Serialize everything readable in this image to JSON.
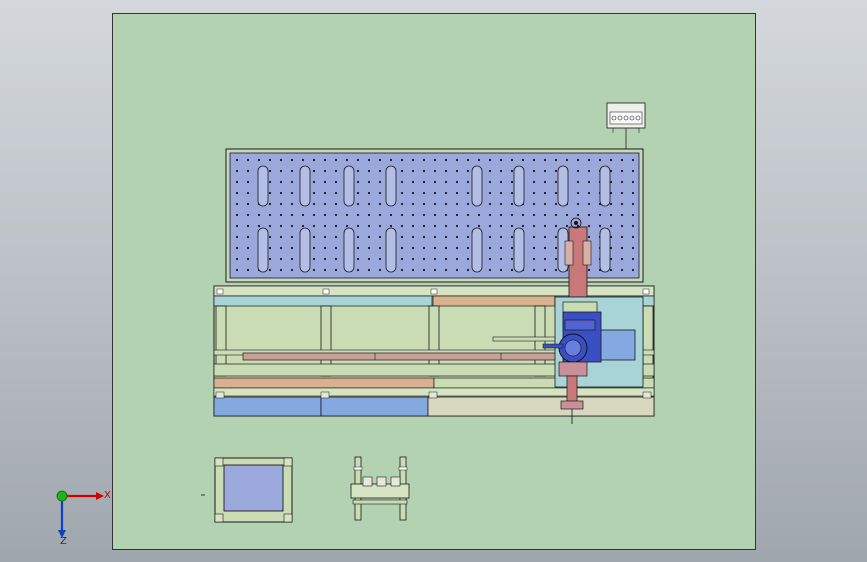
{
  "viewport": {
    "background": "#c7ccd1",
    "sheet_color": "#b3d2b2"
  },
  "drawing": {
    "line_color": "#1a1a1a",
    "plate_color": "#9ba8dc",
    "frame_color": "#c9dcb4",
    "panel_tan": "#d8b28e",
    "panel_blue": "#84a8e0",
    "panel_cyan": "#a8d4d8",
    "motor_blue": "#3b4fc4",
    "rail_color": "#c8a098",
    "column_color": "#c87878"
  },
  "triad": {
    "x_label": "X",
    "z_label": "Z",
    "x_color": "#d00000",
    "y_color": "#00a000",
    "z_color": "#1040c0"
  },
  "icons": [
    "coordinate-triad-icon"
  ]
}
